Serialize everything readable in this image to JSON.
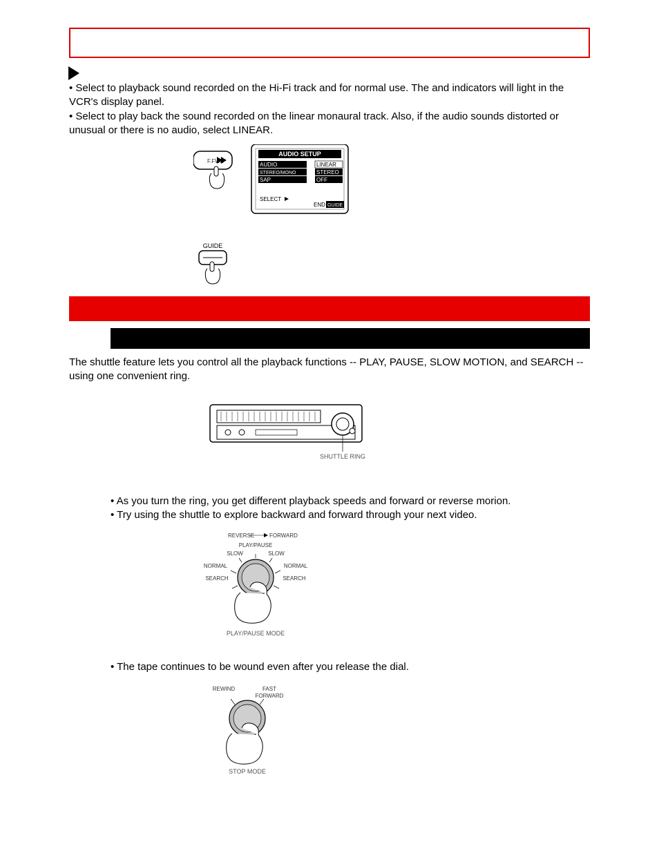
{
  "step3": {
    "title": "",
    "bullet1_a": "• Select ",
    "bullet1_mid": " to playback sound recorded on the Hi-Fi track and for normal use.  The ",
    "bullet1_mid2": " and ",
    "bullet1_end": " indicators will light in the VCR's display panel.",
    "bullet2_a": "• Select ",
    "bullet2_end": " to play back the sound recorded on the linear monaural track. Also, if the audio sounds distorted or unusual or there is no audio, select LINEAR."
  },
  "menu": {
    "title": "AUDIO SETUP",
    "row1_l": "AUDIO",
    "row1_r": "LINEAR",
    "row2_l": "STEREO/MONO",
    "row2_r": "STEREO",
    "row3_l": "SAP",
    "row3_r": "OFF",
    "select": "SELECT",
    "end": "END",
    "guide": "GUIDE"
  },
  "ffwd_btn": "F.FWD",
  "guide_btn": "GUIDE",
  "shuttle": {
    "section_title": "",
    "subsection_title": "",
    "intro": "The shuttle feature lets you control all the playback functions -- PLAY, PAUSE, SLOW MOTION, and SEARCH -- using one convenient ring.",
    "ring_label": "SHUTTLE RING",
    "bullet1": "• As you turn the ring, you get different playback speeds and forward or reverse morion.",
    "bullet2": "• Try using the shuttle to explore backward and forward through your next video.",
    "dial1": {
      "rev": "REVERSE",
      "fwd": "FORWARD",
      "pp": "PLAY/PAUSE",
      "slow": "SLOW",
      "normal": "NORMAL",
      "search": "SEARCH",
      "mode": "PLAY/PAUSE MODE"
    },
    "bullet3": "• The tape continues to be wound even after you release the dial.",
    "dial2": {
      "rew": "REWIND",
      "ff1": "FAST",
      "ff2": "FORWARD",
      "mode": "STOP MODE"
    }
  }
}
